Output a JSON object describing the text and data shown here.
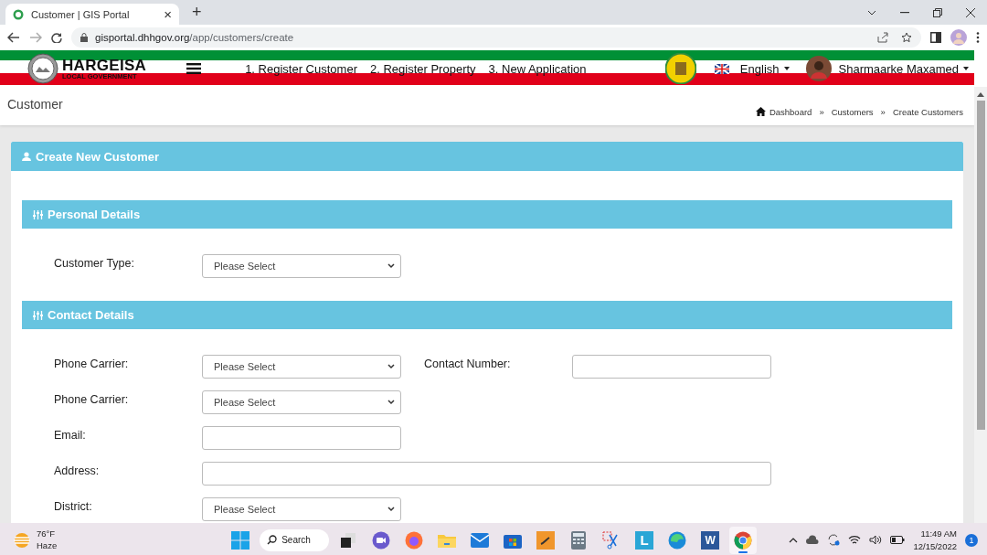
{
  "browser": {
    "tab_title": "Customer | GIS Portal",
    "tab_close": "×",
    "new_tab": "+",
    "url_host": "gisportal.dhhgov.org",
    "url_path": "/app/customers/create"
  },
  "header": {
    "logo_title": "HARGEISA",
    "logo_subtitle": "LOCAL GOVERNMENT",
    "nav": [
      "1. Register Customer",
      "2. Register Property",
      "3. New Application"
    ],
    "language": "English",
    "user": "Sharmaarke Maxamed"
  },
  "page": {
    "title": "Customer",
    "breadcrumb": [
      {
        "kind": "home",
        "label": "Dashboard"
      },
      {
        "kind": "separator",
        "label": "»"
      },
      {
        "kind": "link",
        "label": "Customers"
      },
      {
        "kind": "separator",
        "label": "»"
      },
      {
        "kind": "link",
        "label": "Create Customers"
      }
    ]
  },
  "card": {
    "title": "Create New Customer",
    "sections": [
      {
        "title": "Personal Details",
        "rows": [
          [
            {
              "kind": "select",
              "label": "Customer Type:",
              "value": "Please Select"
            }
          ]
        ]
      },
      {
        "title": "Contact Details",
        "rows": [
          [
            {
              "kind": "select",
              "label": "Phone Carrier:",
              "value": "Please Select"
            },
            {
              "kind": "input",
              "label": "Contact Number:"
            }
          ],
          [
            {
              "kind": "select",
              "label": "Phone Carrier:",
              "value": "Please Select"
            }
          ],
          [
            {
              "kind": "input",
              "label": "Email:"
            }
          ],
          [
            {
              "kind": "wide-input",
              "label": "Address:"
            }
          ],
          [
            {
              "kind": "select",
              "label": "District:",
              "value": "Please Select"
            }
          ]
        ]
      }
    ]
  },
  "taskbar": {
    "weather": {
      "temp": "76°F",
      "condition": "Haze"
    },
    "search": "Search",
    "apps": [
      {
        "kind": "start",
        "selected": false
      },
      {
        "kind": "search",
        "selected": false
      },
      {
        "kind": "taskview",
        "selected": false
      },
      {
        "kind": "chat",
        "selected": false
      },
      {
        "kind": "firefox",
        "selected": false
      },
      {
        "kind": "folder",
        "selected": false
      },
      {
        "kind": "mail",
        "selected": false
      },
      {
        "kind": "store",
        "selected": false
      },
      {
        "kind": "photo",
        "selected": false
      },
      {
        "kind": "calculator",
        "selected": false
      },
      {
        "kind": "snip",
        "selected": false
      },
      {
        "kind": "letter",
        "label": "L",
        "selected": false
      },
      {
        "kind": "edge",
        "selected": false
      },
      {
        "kind": "word",
        "label": "W",
        "selected": false
      },
      {
        "kind": "chrome",
        "selected": true
      }
    ],
    "time": "11:49 AM",
    "date": "12/15/2022",
    "notifications": "1"
  }
}
